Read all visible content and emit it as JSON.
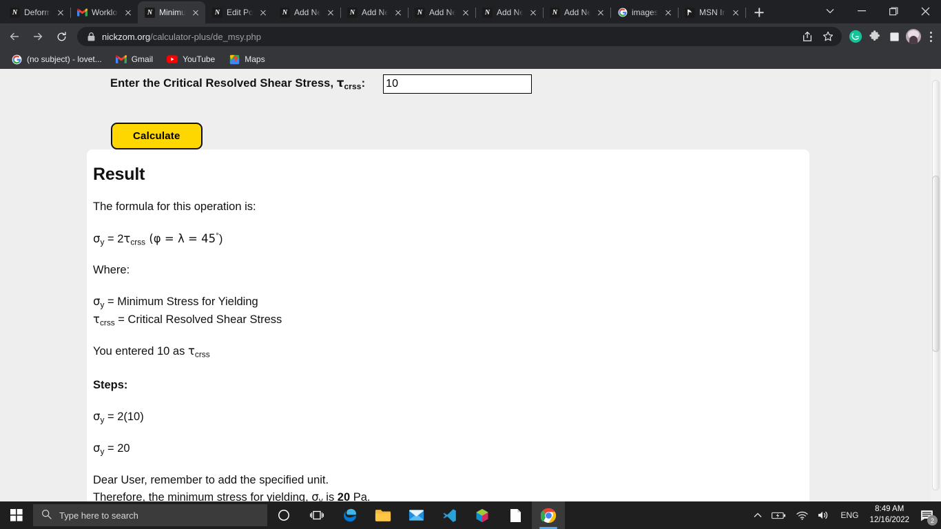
{
  "browser": {
    "tabs": [
      {
        "title": "Deformation",
        "favicon": "nickzom-icon",
        "active": false
      },
      {
        "title": "Workload",
        "favicon": "gmail-icon",
        "active": false
      },
      {
        "title": "Minimum Stress for Yielding",
        "favicon": "nickzom-icon",
        "active": true
      },
      {
        "title": "Edit Post",
        "favicon": "nickzom-icon",
        "active": false
      },
      {
        "title": "Add New",
        "favicon": "nickzom-icon",
        "active": false
      },
      {
        "title": "Add New",
        "favicon": "nickzom-icon",
        "active": false
      },
      {
        "title": "Add New",
        "favicon": "nickzom-icon",
        "active": false
      },
      {
        "title": "Add New",
        "favicon": "nickzom-icon",
        "active": false
      },
      {
        "title": "Add New",
        "favicon": "nickzom-icon",
        "active": false
      },
      {
        "title": "images",
        "favicon": "google-icon",
        "active": false
      },
      {
        "title": "MSN India",
        "favicon": "msn-icon",
        "active": false
      }
    ],
    "new_tab_label": "+",
    "url_domain": "nickzom.org",
    "url_path": "/calculator-plus/de_msy.php",
    "bookmarks": [
      {
        "label": "(no subject) - lovet...",
        "icon": "google-icon"
      },
      {
        "label": "Gmail",
        "icon": "gmail-icon"
      },
      {
        "label": "YouTube",
        "icon": "youtube-icon"
      },
      {
        "label": "Maps",
        "icon": "maps-icon"
      }
    ]
  },
  "form": {
    "label_prefix": "Enter the Critical Resolved Shear Stress, ",
    "label_symbol": "τ",
    "label_sub": "crss",
    "label_suffix": ":",
    "input_value": "10",
    "input_placeholder": "",
    "calculate_label": "Calculate"
  },
  "result": {
    "heading": "Result",
    "formula_intro": "The formula for this operation is:",
    "formula": {
      "sigma": "σ",
      "sigma_sub": "y",
      "equals_2": " = 2",
      "tau": "τ",
      "tau_sub": "crss",
      "condition": " (φ = λ = 45",
      "degree": "°",
      "close": ")"
    },
    "where_label": "Where:",
    "definitions": [
      {
        "symbol": "σ",
        "sub": "y",
        "text": " = Minimum Stress for Yielding"
      },
      {
        "symbol": "τ",
        "sub": "crss",
        "text": " = Critical Resolved Shear Stress"
      }
    ],
    "entered_prefix": "You entered ",
    "entered_value": "10",
    "entered_mid": " as ",
    "entered_symbol": "τ",
    "entered_sub": "crss",
    "steps_label": "Steps:",
    "step_1": {
      "symbol": "σ",
      "sub": "y",
      "text": " = 2(10)"
    },
    "step_2": {
      "symbol": "σ",
      "sub": "y",
      "text": " = 20"
    },
    "note_line1": "Dear User, remember to add the specified unit.",
    "note_line2_prefix": "Therefore, the minimum stress for yielding, ",
    "note_symbol": "σ",
    "note_sub": "y",
    "note_line2_mid": " is ",
    "note_answer": "20",
    "note_line2_suffix": " Pa."
  },
  "taskbar": {
    "search_placeholder": "Type here to search",
    "apps": [
      {
        "name": "cortana"
      },
      {
        "name": "task-view"
      },
      {
        "name": "edge"
      },
      {
        "name": "file-explorer"
      },
      {
        "name": "mail"
      },
      {
        "name": "vscode"
      },
      {
        "name": "3d-viewer"
      },
      {
        "name": "notepad"
      },
      {
        "name": "chrome"
      }
    ],
    "language": "ENG",
    "time": "8:49 AM",
    "date": "12/16/2022",
    "notification_count": "2"
  },
  "colors": {
    "accent_yellow": "#FFD700",
    "page_bg": "#EEEEEE",
    "card_bg": "#FFFFFF",
    "chrome_bg": "#202124"
  }
}
